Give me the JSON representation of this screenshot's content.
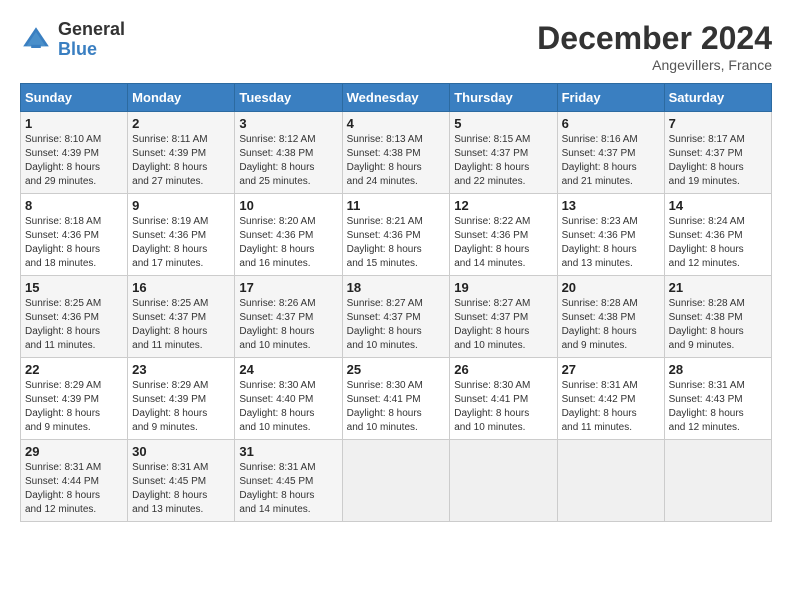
{
  "header": {
    "logo_general": "General",
    "logo_blue": "Blue",
    "month_title": "December 2024",
    "subtitle": "Angevillers, France"
  },
  "days_of_week": [
    "Sunday",
    "Monday",
    "Tuesday",
    "Wednesday",
    "Thursday",
    "Friday",
    "Saturday"
  ],
  "weeks": [
    [
      {
        "day": "1",
        "info": "Sunrise: 8:10 AM\nSunset: 4:39 PM\nDaylight: 8 hours\nand 29 minutes."
      },
      {
        "day": "2",
        "info": "Sunrise: 8:11 AM\nSunset: 4:39 PM\nDaylight: 8 hours\nand 27 minutes."
      },
      {
        "day": "3",
        "info": "Sunrise: 8:12 AM\nSunset: 4:38 PM\nDaylight: 8 hours\nand 25 minutes."
      },
      {
        "day": "4",
        "info": "Sunrise: 8:13 AM\nSunset: 4:38 PM\nDaylight: 8 hours\nand 24 minutes."
      },
      {
        "day": "5",
        "info": "Sunrise: 8:15 AM\nSunset: 4:37 PM\nDaylight: 8 hours\nand 22 minutes."
      },
      {
        "day": "6",
        "info": "Sunrise: 8:16 AM\nSunset: 4:37 PM\nDaylight: 8 hours\nand 21 minutes."
      },
      {
        "day": "7",
        "info": "Sunrise: 8:17 AM\nSunset: 4:37 PM\nDaylight: 8 hours\nand 19 minutes."
      }
    ],
    [
      {
        "day": "8",
        "info": "Sunrise: 8:18 AM\nSunset: 4:36 PM\nDaylight: 8 hours\nand 18 minutes."
      },
      {
        "day": "9",
        "info": "Sunrise: 8:19 AM\nSunset: 4:36 PM\nDaylight: 8 hours\nand 17 minutes."
      },
      {
        "day": "10",
        "info": "Sunrise: 8:20 AM\nSunset: 4:36 PM\nDaylight: 8 hours\nand 16 minutes."
      },
      {
        "day": "11",
        "info": "Sunrise: 8:21 AM\nSunset: 4:36 PM\nDaylight: 8 hours\nand 15 minutes."
      },
      {
        "day": "12",
        "info": "Sunrise: 8:22 AM\nSunset: 4:36 PM\nDaylight: 8 hours\nand 14 minutes."
      },
      {
        "day": "13",
        "info": "Sunrise: 8:23 AM\nSunset: 4:36 PM\nDaylight: 8 hours\nand 13 minutes."
      },
      {
        "day": "14",
        "info": "Sunrise: 8:24 AM\nSunset: 4:36 PM\nDaylight: 8 hours\nand 12 minutes."
      }
    ],
    [
      {
        "day": "15",
        "info": "Sunrise: 8:25 AM\nSunset: 4:36 PM\nDaylight: 8 hours\nand 11 minutes."
      },
      {
        "day": "16",
        "info": "Sunrise: 8:25 AM\nSunset: 4:37 PM\nDaylight: 8 hours\nand 11 minutes."
      },
      {
        "day": "17",
        "info": "Sunrise: 8:26 AM\nSunset: 4:37 PM\nDaylight: 8 hours\nand 10 minutes."
      },
      {
        "day": "18",
        "info": "Sunrise: 8:27 AM\nSunset: 4:37 PM\nDaylight: 8 hours\nand 10 minutes."
      },
      {
        "day": "19",
        "info": "Sunrise: 8:27 AM\nSunset: 4:37 PM\nDaylight: 8 hours\nand 10 minutes."
      },
      {
        "day": "20",
        "info": "Sunrise: 8:28 AM\nSunset: 4:38 PM\nDaylight: 8 hours\nand 9 minutes."
      },
      {
        "day": "21",
        "info": "Sunrise: 8:28 AM\nSunset: 4:38 PM\nDaylight: 8 hours\nand 9 minutes."
      }
    ],
    [
      {
        "day": "22",
        "info": "Sunrise: 8:29 AM\nSunset: 4:39 PM\nDaylight: 8 hours\nand 9 minutes."
      },
      {
        "day": "23",
        "info": "Sunrise: 8:29 AM\nSunset: 4:39 PM\nDaylight: 8 hours\nand 9 minutes."
      },
      {
        "day": "24",
        "info": "Sunrise: 8:30 AM\nSunset: 4:40 PM\nDaylight: 8 hours\nand 10 minutes."
      },
      {
        "day": "25",
        "info": "Sunrise: 8:30 AM\nSunset: 4:41 PM\nDaylight: 8 hours\nand 10 minutes."
      },
      {
        "day": "26",
        "info": "Sunrise: 8:30 AM\nSunset: 4:41 PM\nDaylight: 8 hours\nand 10 minutes."
      },
      {
        "day": "27",
        "info": "Sunrise: 8:31 AM\nSunset: 4:42 PM\nDaylight: 8 hours\nand 11 minutes."
      },
      {
        "day": "28",
        "info": "Sunrise: 8:31 AM\nSunset: 4:43 PM\nDaylight: 8 hours\nand 12 minutes."
      }
    ],
    [
      {
        "day": "29",
        "info": "Sunrise: 8:31 AM\nSunset: 4:44 PM\nDaylight: 8 hours\nand 12 minutes."
      },
      {
        "day": "30",
        "info": "Sunrise: 8:31 AM\nSunset: 4:45 PM\nDaylight: 8 hours\nand 13 minutes."
      },
      {
        "day": "31",
        "info": "Sunrise: 8:31 AM\nSunset: 4:45 PM\nDaylight: 8 hours\nand 14 minutes."
      },
      {
        "day": "",
        "info": ""
      },
      {
        "day": "",
        "info": ""
      },
      {
        "day": "",
        "info": ""
      },
      {
        "day": "",
        "info": ""
      }
    ]
  ]
}
